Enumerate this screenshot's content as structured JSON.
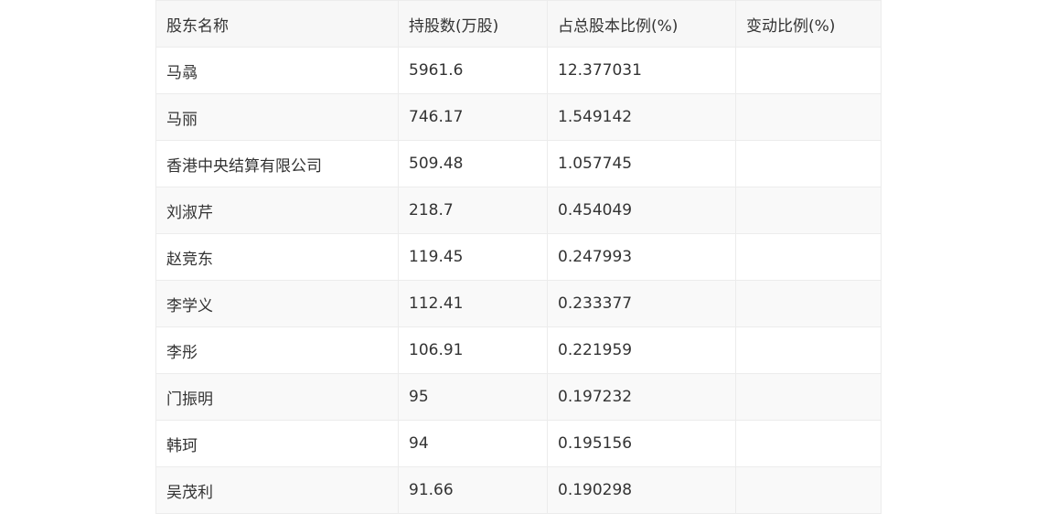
{
  "table": {
    "headers": [
      "股东名称",
      "持股数(万股)",
      "占总股本比例(%)",
      "变动比例(%)"
    ],
    "rows": [
      [
        "马骉",
        "5961.6",
        "12.377031",
        ""
      ],
      [
        "马丽",
        "746.17",
        "1.549142",
        ""
      ],
      [
        "香港中央结算有限公司",
        "509.48",
        "1.057745",
        ""
      ],
      [
        "刘淑芹",
        "218.7",
        "0.454049",
        ""
      ],
      [
        "赵竞东",
        "119.45",
        "0.247993",
        ""
      ],
      [
        "李学义",
        "112.41",
        "0.233377",
        ""
      ],
      [
        "李彤",
        "106.91",
        "0.221959",
        ""
      ],
      [
        "门振明",
        "95",
        "0.197232",
        ""
      ],
      [
        "韩珂",
        "94",
        "0.195156",
        ""
      ],
      [
        "吴茂利",
        "91.66",
        "0.190298",
        ""
      ]
    ]
  },
  "colors": {
    "header_bg": "#f7f7f7",
    "row_alt_bg": "#f9f9f9",
    "border": "#ececec",
    "text": "#333333"
  }
}
